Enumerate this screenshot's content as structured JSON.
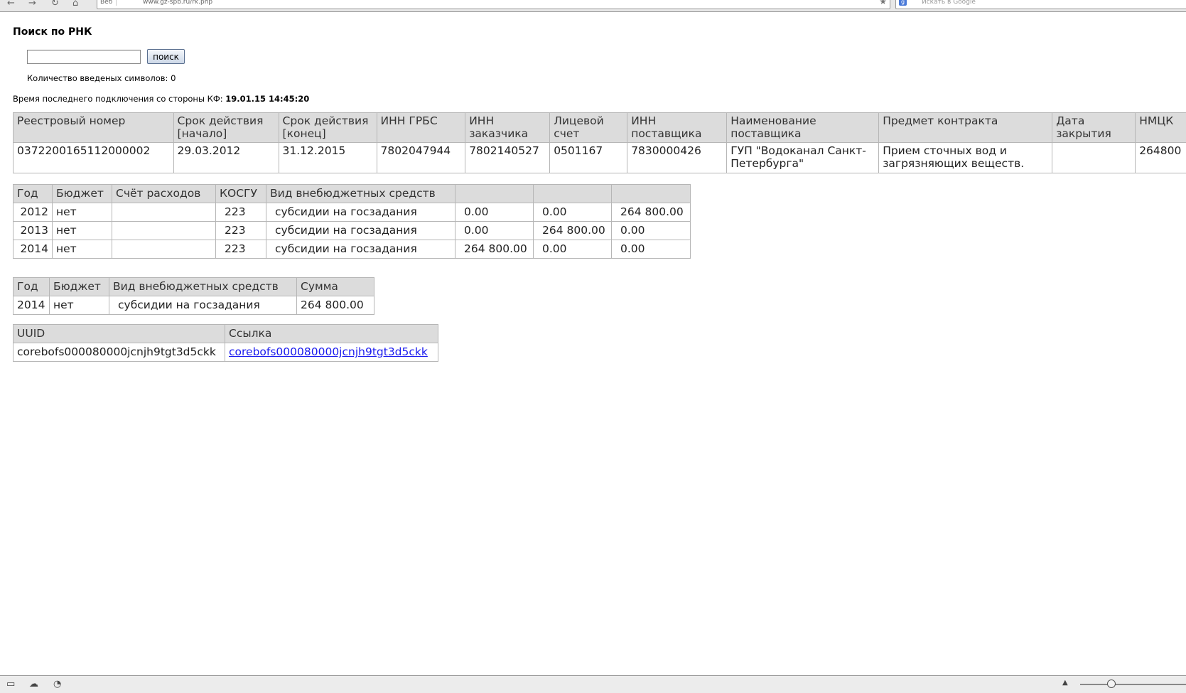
{
  "browser": {
    "nav_back": "←",
    "nav_forward": "→",
    "nav_reload": "↻",
    "nav_home": "⌂",
    "url_protocol": "Веб",
    "url": "www.gz-spb.ru/rk.php",
    "search_placeholder": "Искать в Google",
    "search_engine": "g"
  },
  "page": {
    "title": "Поиск по РНК",
    "search": {
      "value": "",
      "placeholder": "",
      "button_label": "поиск"
    },
    "char_count_label": "Количество введеных символов: 0",
    "last_connection_label": "Время последнего подключения со стороны КФ:",
    "last_connection_value": "19.01.15 14:45:20"
  },
  "contract_table": {
    "headers": [
      "Реестровый номер",
      "Срок действия [начало]",
      "Срок действия [конец]",
      "ИНН ГРБС",
      "ИНН заказчика",
      "Лицевой счет",
      "ИНН поставщика",
      "Наименование поставщика",
      "Предмет контракта",
      "Дата закрытия",
      "НМЦК"
    ],
    "row": [
      "0372200165112000002",
      "29.03.2012",
      "31.12.2015",
      "7802047944",
      "7802140527",
      "0501167",
      "7830000426",
      "ГУП \"Водоканал Санкт-Петербурга\"",
      "Прием сточных вод и загрязняющих веществ.",
      "",
      "264800"
    ]
  },
  "budget_table": {
    "headers": [
      "Год",
      "Бюджет",
      "Счёт расходов",
      "КОСГУ",
      "Вид внебюджетных средств",
      "",
      "",
      ""
    ],
    "rows": [
      [
        "2012",
        "нет",
        "",
        "223",
        "субсидии на госзадания",
        "0.00",
        "0.00",
        "264 800.00"
      ],
      [
        "2013",
        "нет",
        "",
        "223",
        "субсидии на госзадания",
        "0.00",
        "264 800.00",
        "0.00"
      ],
      [
        "2014",
        "нет",
        "",
        "223",
        "субсидии на госзадания",
        "264 800.00",
        "0.00",
        "0.00"
      ]
    ]
  },
  "sum_table": {
    "headers": [
      "Год",
      "Бюджет",
      "Вид внебюджетных средств",
      "Сумма"
    ],
    "rows": [
      [
        "2014",
        "нет",
        "субсидии на госзадания",
        "264 800.00"
      ]
    ]
  },
  "uuid_table": {
    "headers": [
      "UUID",
      "Ссылка"
    ],
    "rows": [
      [
        "corebofs000080000jcnjh9tgt3d5ckk",
        "corebofs000080000jcnjh9tgt3d5ckk"
      ]
    ]
  },
  "statusbar": {
    "icons": [
      "panel-icon",
      "cloud-icon",
      "speed-icon"
    ],
    "zoom_arrow": "▲"
  }
}
